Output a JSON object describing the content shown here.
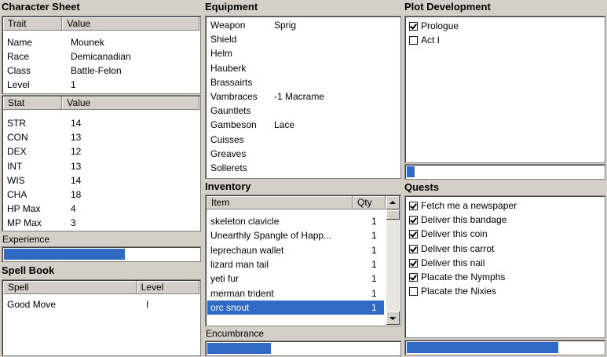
{
  "character_sheet": {
    "title": "Character Sheet",
    "trait_headers": [
      "Trait",
      "Value"
    ],
    "traits": [
      {
        "name": "Name",
        "value": "Mounek"
      },
      {
        "name": "Race",
        "value": "Demicanadian"
      },
      {
        "name": "Class",
        "value": "Battle-Felon"
      },
      {
        "name": "Level",
        "value": "1"
      }
    ],
    "stat_headers": [
      "Stat",
      "Value"
    ],
    "stats": [
      {
        "name": "STR",
        "value": "14"
      },
      {
        "name": "CON",
        "value": "13"
      },
      {
        "name": "DEX",
        "value": "12"
      },
      {
        "name": "INT",
        "value": "13"
      },
      {
        "name": "WIS",
        "value": "14"
      },
      {
        "name": "CHA",
        "value": "18"
      },
      {
        "name": "HP Max",
        "value": "4"
      },
      {
        "name": "MP Max",
        "value": "3"
      }
    ],
    "experience_label": "Experience",
    "experience_progress": 0.62
  },
  "spell_book": {
    "title": "Spell Book",
    "headers": [
      "Spell",
      "Level"
    ],
    "spells": [
      {
        "name": "Good Move",
        "level": "I"
      }
    ]
  },
  "equipment": {
    "title": "Equipment",
    "items": [
      {
        "slot": "Weapon",
        "item": "Sprig"
      },
      {
        "slot": "Shield",
        "item": ""
      },
      {
        "slot": "Helm",
        "item": ""
      },
      {
        "slot": "Hauberk",
        "item": ""
      },
      {
        "slot": "Brassairts",
        "item": ""
      },
      {
        "slot": "Vambraces",
        "item": "-1 Macrame"
      },
      {
        "slot": "Gauntlets",
        "item": ""
      },
      {
        "slot": "Gambeson",
        "item": "Lace"
      },
      {
        "slot": "Cuisses",
        "item": ""
      },
      {
        "slot": "Greaves",
        "item": ""
      },
      {
        "slot": "Sollerets",
        "item": ""
      }
    ]
  },
  "inventory": {
    "title": "Inventory",
    "headers": [
      "Item",
      "Qty"
    ],
    "items": [
      {
        "item": "skeleton clavicle",
        "qty": "1"
      },
      {
        "item": "Unearthly Spangle of Happ...",
        "qty": "1"
      },
      {
        "item": "leprechaun wallet",
        "qty": "1"
      },
      {
        "item": "lizard man tail",
        "qty": "1"
      },
      {
        "item": "yeti fur",
        "qty": "1"
      },
      {
        "item": "merman trident",
        "qty": "1"
      },
      {
        "item": "orc snout",
        "qty": "1"
      }
    ],
    "selected_index": 6,
    "encumbrance_label": "Encumbrance",
    "encumbrance_progress": 0.33
  },
  "plot": {
    "title": "Plot Development",
    "acts": [
      {
        "label": "Prologue",
        "checked": true
      },
      {
        "label": "Act I",
        "checked": false
      }
    ],
    "progress": 0.04
  },
  "quests": {
    "title": "Quests",
    "items": [
      {
        "label": "Fetch me a newspaper",
        "checked": true
      },
      {
        "label": "Deliver this bandage",
        "checked": true
      },
      {
        "label": "Deliver this coin",
        "checked": true
      },
      {
        "label": "Deliver this carrot",
        "checked": true
      },
      {
        "label": "Deliver this nail",
        "checked": true
      },
      {
        "label": "Placate the Nymphs",
        "checked": true
      },
      {
        "label": "Placate the Nixies",
        "checked": false
      }
    ],
    "progress": 0.77
  },
  "colors": {
    "accent": "#316ac5",
    "face": "#d4d0c8"
  },
  "icons": {
    "scroll_up": "arrow-up-icon",
    "scroll_down": "arrow-down-icon",
    "check": "checkmark-icon"
  }
}
